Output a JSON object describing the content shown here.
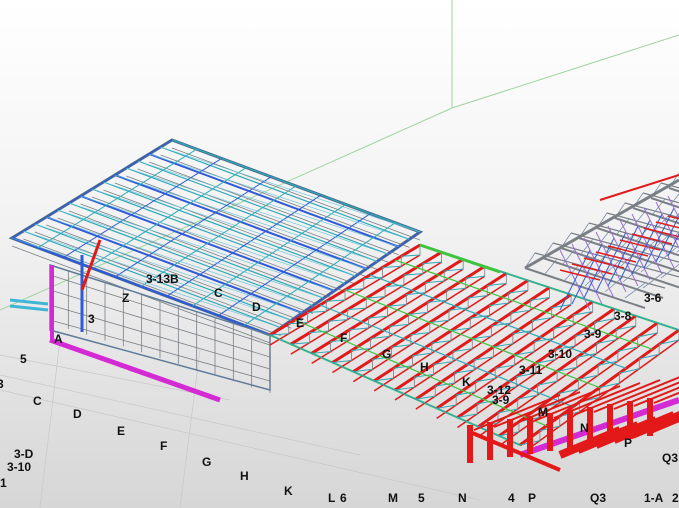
{
  "viewport": {
    "colors": {
      "background_top": "#ffffff",
      "background_bottom": "#d6d6d6",
      "grid_line": "#9fd39f",
      "beam_red": "#e31818",
      "beam_blue": "#2f5ad8",
      "beam_teal": "#2eaab8",
      "beam_green": "#3fc43f",
      "beam_magenta": "#d42ad4",
      "beam_grey": "#7a7f86"
    },
    "grid_labels_left": [
      "5",
      "3",
      "C",
      "D",
      "E",
      "F",
      "G",
      "H",
      "K",
      "L",
      "6",
      "M",
      "5",
      "N",
      "4",
      "P",
      "Q3",
      "1-A",
      "2"
    ],
    "side_labels": [
      "3-D",
      "3-10",
      "1"
    ],
    "roof_labels": [
      "3-13B",
      "Z",
      "C",
      "D",
      "3",
      "A",
      "E",
      "F",
      "G",
      "H",
      "K",
      "3-12",
      "3-9",
      "3-11",
      "3-10",
      "M",
      "N",
      "P",
      "3-9",
      "3-8",
      "3-6",
      "Q3"
    ]
  }
}
